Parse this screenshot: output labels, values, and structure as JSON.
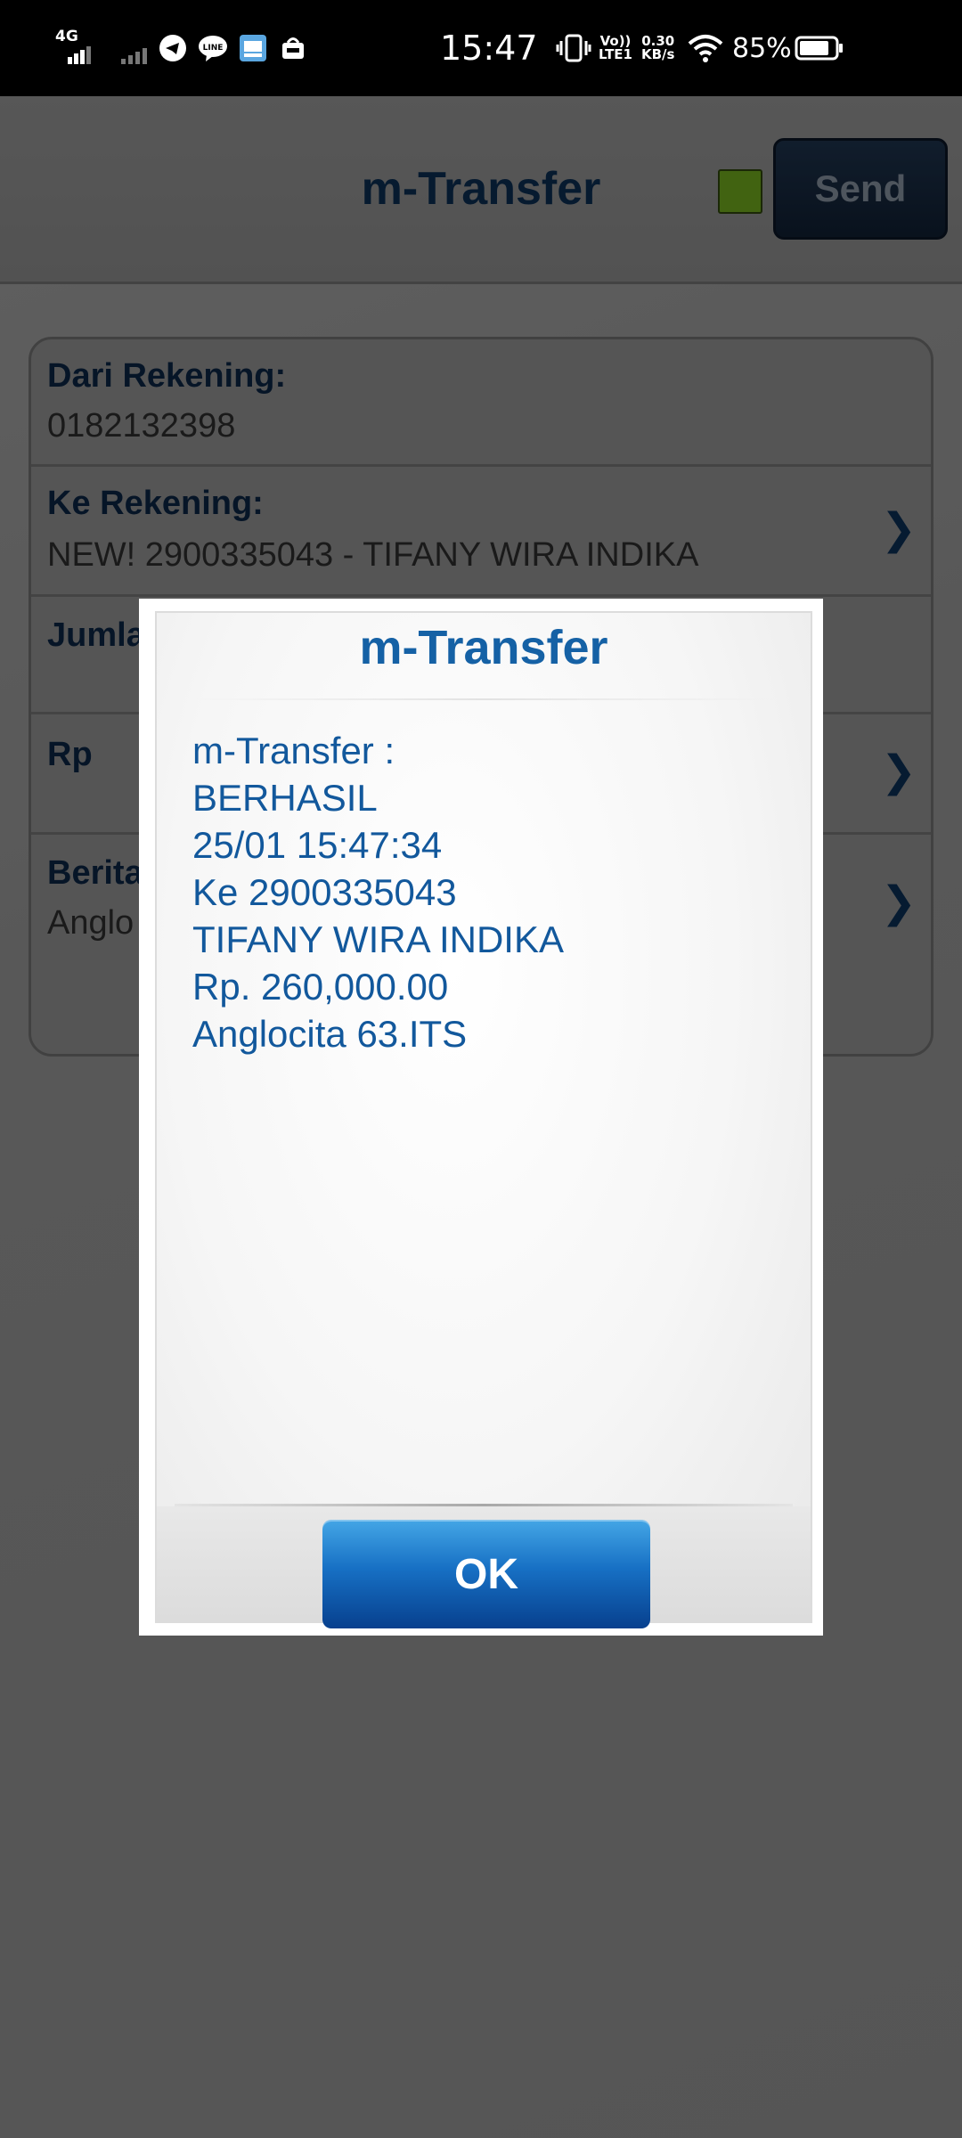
{
  "status_bar": {
    "network": "4G",
    "time": "15:47",
    "volte": "Vo)) LTE1",
    "speed_value": "0.30",
    "speed_unit": "KB/s",
    "battery_percent": "85%",
    "battery_level": 0.85
  },
  "header": {
    "title": "m-Transfer",
    "send_label": "Send",
    "indicator_color": "#6aa01c"
  },
  "form": {
    "from_label": "Dari Rekening:",
    "from_value": "0182132398",
    "to_label": "Ke Rekening:",
    "to_value": "NEW! 2900335043 - TIFANY WIRA INDIKA",
    "amount_label": "Jumla",
    "rp_label": "Rp",
    "note_label": "Berita",
    "note_value": "Anglo"
  },
  "dialog": {
    "title": "m-Transfer",
    "lines": [
      "m-Transfer :",
      "BERHASIL",
      "25/01 15:47:34",
      "Ke 2900335043",
      "TIFANY WIRA INDIKA",
      "Rp. 260,000.00",
      "Anglocita 63.ITS"
    ],
    "ok_label": "OK"
  },
  "colors": {
    "accent_blue": "#1561a5",
    "ok_button": "#1770c4",
    "header_title": "#0b2b4d"
  }
}
